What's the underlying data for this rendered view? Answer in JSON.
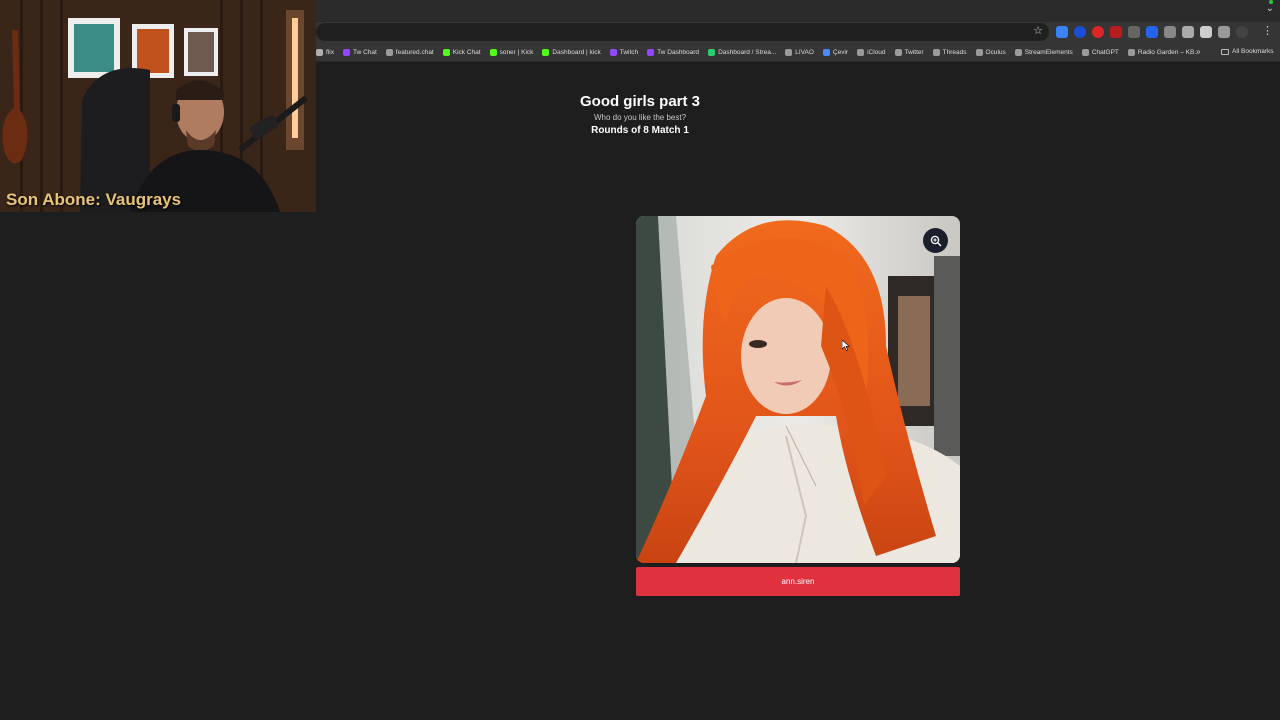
{
  "bookmarks": [
    {
      "label": "flix",
      "color": "#b0b0b0"
    },
    {
      "label": "Tw Chat",
      "color": "#9146ff"
    },
    {
      "label": "featured.chat",
      "color": "#9a9a9a"
    },
    {
      "label": "Kick Chat",
      "color": "#53fc18"
    },
    {
      "label": "soner | Kick",
      "color": "#53fc18"
    },
    {
      "label": "Dashboard | kick",
      "color": "#53fc18"
    },
    {
      "label": "Twitch",
      "color": "#9146ff"
    },
    {
      "label": "Tw Dashboard",
      "color": "#9146ff"
    },
    {
      "label": "Dashboard / Strea...",
      "color": "#2ecc71"
    },
    {
      "label": "LIVAO",
      "color": "#9a9a9a"
    },
    {
      "label": "Çevir",
      "color": "#4c8bf5"
    },
    {
      "label": "iCloud",
      "color": "#9a9a9a"
    },
    {
      "label": "Twitter",
      "color": "#9a9a9a"
    },
    {
      "label": "Threads",
      "color": "#9a9a9a"
    },
    {
      "label": "Oculus",
      "color": "#9a9a9a"
    },
    {
      "label": "StreamElements",
      "color": "#9a9a9a"
    },
    {
      "label": "ChatGPT",
      "color": "#9a9a9a"
    },
    {
      "label": "Radio Garden – KB...",
      "color": "#9a9a9a"
    }
  ],
  "bookmarks_more": "»",
  "all_bookmarks": "All Bookmarks",
  "page": {
    "title": "Good girls part 3",
    "subtitle": "Who do you like the best?",
    "round": "Rounds of 8 Match 1"
  },
  "candidate": {
    "name": "ann.siren",
    "button_color": "#e0313f"
  },
  "webcam": {
    "caption": "Son Abone: Vaugrays"
  },
  "icons": {
    "zoom": "zoom-in-icon",
    "star": "bookmark-star-icon",
    "menu": "menu-dots-icon"
  }
}
